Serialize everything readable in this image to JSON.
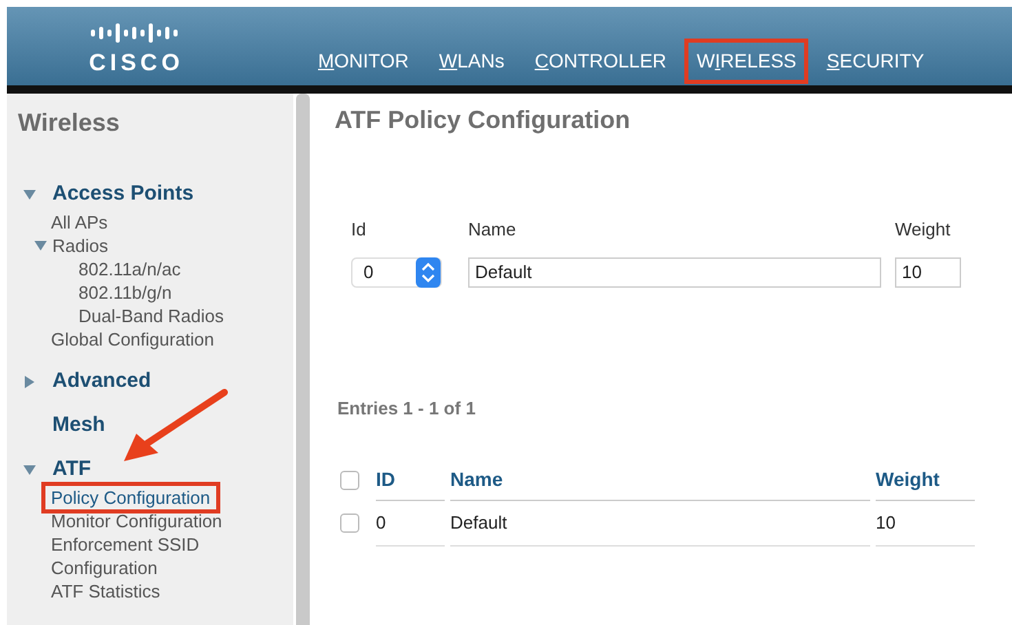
{
  "header": {
    "logo": "CISCO",
    "nav": [
      {
        "key": "M",
        "post": "ONITOR",
        "highlighted": false
      },
      {
        "key": "W",
        "post": "LANs",
        "highlighted": false
      },
      {
        "key": "C",
        "post": "ONTROLLER",
        "highlighted": false
      },
      {
        "pre": "W",
        "key": "I",
        "post": "RELESS",
        "highlighted": true
      },
      {
        "key": "S",
        "post": "ECURITY",
        "highlighted": false
      }
    ]
  },
  "sidebar": {
    "title": "Wireless",
    "annotation_arrow": true,
    "sections": [
      {
        "label": "Access Points",
        "kind": "group",
        "expanded": true,
        "items": [
          {
            "label": "All APs",
            "kind": "link",
            "selected": false,
            "highlighted": false
          },
          {
            "label": "Radios",
            "kind": "group",
            "expanded": true,
            "children": [
              {
                "label": "802.11a/n/ac",
                "selected": false,
                "highlighted": false
              },
              {
                "label": "802.11b/g/n",
                "selected": false,
                "highlighted": false
              },
              {
                "label": "Dual-Band Radios",
                "selected": false,
                "highlighted": false
              }
            ]
          },
          {
            "label": "Global Configuration",
            "kind": "link",
            "selected": false,
            "highlighted": false
          }
        ]
      },
      {
        "label": "Advanced",
        "kind": "group",
        "expanded": false
      },
      {
        "label": "Mesh",
        "kind": "link"
      },
      {
        "label": "ATF",
        "kind": "group",
        "expanded": true,
        "items": [
          {
            "label": "Policy Configuration",
            "kind": "link",
            "selected": true,
            "highlighted": true
          },
          {
            "label": "Monitor Configuration",
            "kind": "link",
            "selected": false,
            "highlighted": false
          },
          {
            "label": "Enforcement SSID Configuration",
            "kind": "link",
            "selected": false,
            "highlighted": false
          },
          {
            "label": "ATF Statistics",
            "kind": "link",
            "selected": false,
            "highlighted": false
          }
        ]
      }
    ]
  },
  "main": {
    "title": "ATF Policy Configuration",
    "form": {
      "id_label": "Id",
      "id_value": "0",
      "name_label": "Name",
      "name_value": "Default",
      "weight_label": "Weight",
      "weight_value": "10"
    },
    "entries": "Entries 1 - 1 of 1",
    "table": {
      "columns": [
        "ID",
        "Name",
        "Weight"
      ],
      "all_checked": false,
      "rows": [
        {
          "cells": [
            "0",
            "Default",
            "10"
          ],
          "checked": false
        }
      ]
    }
  }
}
